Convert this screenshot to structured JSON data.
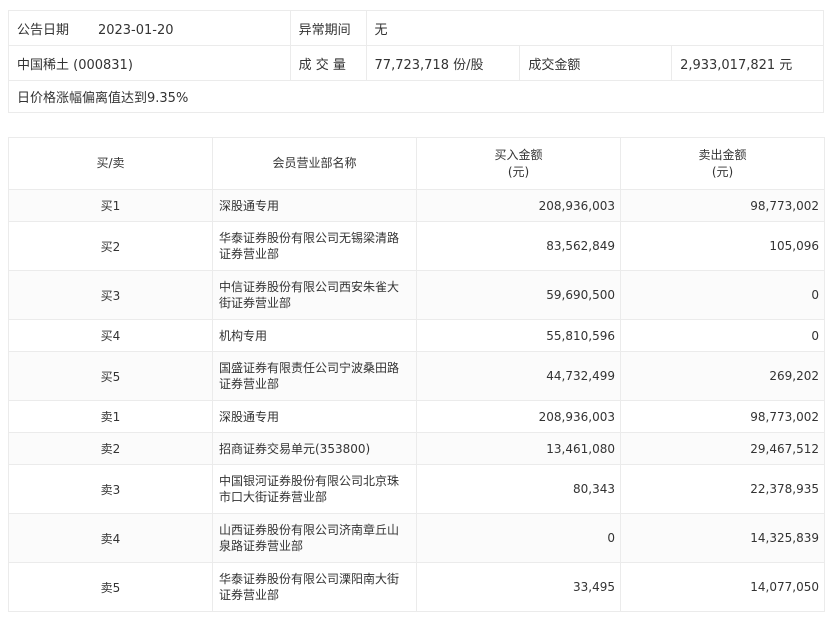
{
  "info": {
    "announce_date_label": "公告日期",
    "announce_date": "2023-01-20",
    "abnormal_period_label": "异常期间",
    "abnormal_period": "无",
    "stock": "中国稀土 (000831)",
    "volume_label": "成 交 量",
    "volume": "77,723,718 份/股",
    "turnover_label": "成交金额",
    "turnover": "2,933,017,821 元",
    "reason": "日价格涨幅偏离值达到9.35%"
  },
  "table": {
    "headers": {
      "side": "买/卖",
      "branch": "会员营业部名称",
      "buy_amount_1": "买入金额",
      "buy_amount_2": "(元)",
      "sell_amount_1": "卖出金额",
      "sell_amount_2": "(元)"
    },
    "rows": [
      {
        "side": "买1",
        "branch": "深股通专用",
        "buy": "208,936,003",
        "sell": "98,773,002"
      },
      {
        "side": "买2",
        "branch": "华泰证券股份有限公司无锡梁清路证券营业部",
        "buy": "83,562,849",
        "sell": "105,096"
      },
      {
        "side": "买3",
        "branch": "中信证券股份有限公司西安朱雀大街证券营业部",
        "buy": "59,690,500",
        "sell": "0"
      },
      {
        "side": "买4",
        "branch": "机构专用",
        "buy": "55,810,596",
        "sell": "0"
      },
      {
        "side": "买5",
        "branch": "国盛证券有限责任公司宁波桑田路证券营业部",
        "buy": "44,732,499",
        "sell": "269,202"
      },
      {
        "side": "卖1",
        "branch": "深股通专用",
        "buy": "208,936,003",
        "sell": "98,773,002"
      },
      {
        "side": "卖2",
        "branch": "招商证券交易单元(353800)",
        "buy": "13,461,080",
        "sell": "29,467,512"
      },
      {
        "side": "卖3",
        "branch": "中国银河证券股份有限公司北京珠市口大街证券营业部",
        "buy": "80,343",
        "sell": "22,378,935"
      },
      {
        "side": "卖4",
        "branch": "山西证券股份有限公司济南章丘山泉路证券营业部",
        "buy": "0",
        "sell": "14,325,839"
      },
      {
        "side": "卖5",
        "branch": "华泰证券股份有限公司溧阳南大街证券营业部",
        "buy": "33,495",
        "sell": "14,077,050"
      }
    ]
  }
}
